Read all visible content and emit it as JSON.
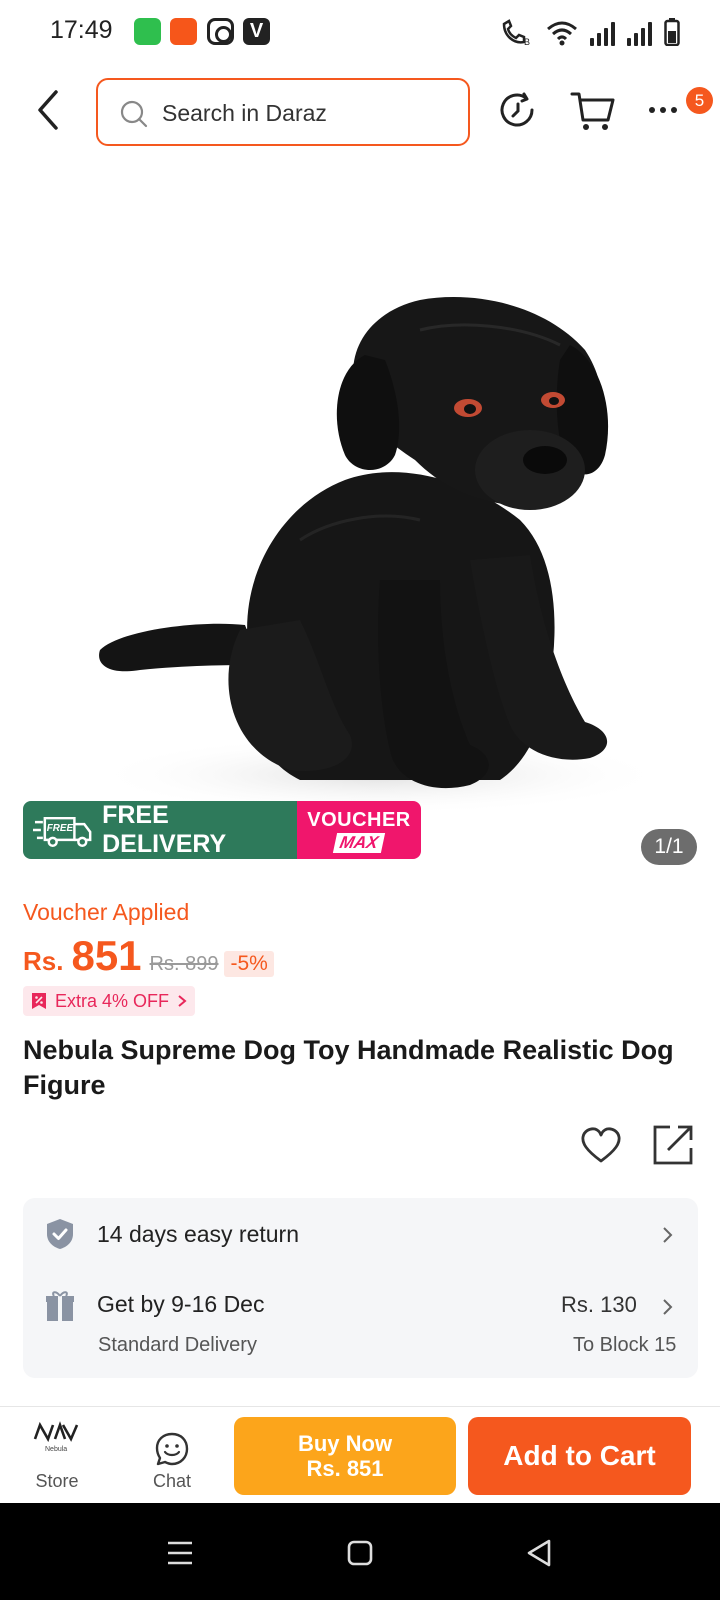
{
  "status_bar": {
    "time": "17:49"
  },
  "search": {
    "placeholder": "Search in Daraz"
  },
  "header": {
    "cart_badge": "5"
  },
  "gallery": {
    "counter": "1/1",
    "promo": {
      "free_tag": "FREE",
      "free_delivery": "FREE DELIVERY",
      "voucher_line1": "VOUCHER",
      "voucher_line2": "MAX"
    }
  },
  "price": {
    "voucher_applied": "Voucher Applied",
    "currency": "Rs.",
    "amount": "851",
    "original": "Rs. 899",
    "discount": "-5%",
    "extra_off": "Extra 4% OFF"
  },
  "product": {
    "title": "Nebula Supreme Dog Toy Handmade Realistic Dog Figure"
  },
  "services": {
    "return_label": "14 days easy return",
    "delivery_label": "Get by 9-16 Dec",
    "delivery_type": "Standard Delivery",
    "delivery_fee": "Rs. 130",
    "delivery_to": "To Block 15"
  },
  "bottom_bar": {
    "store_label": "Store",
    "store_logo_text": "Nebula",
    "chat_label": "Chat",
    "buy_now_line1": "Buy Now",
    "buy_now_line2": "Rs. 851",
    "add_to_cart": "Add to Cart"
  },
  "colors": {
    "accent": "#f5581e",
    "buy_now": "#fca51b",
    "free_delivery_green": "#2e7a5b",
    "voucher_pink": "#f0166c"
  }
}
